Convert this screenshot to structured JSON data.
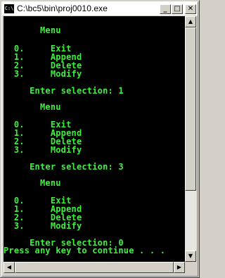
{
  "window": {
    "title": "C:\\bc5\\bin\\proj0010.exe",
    "icon": "C:\\",
    "buttons": {
      "minimize": "_",
      "maximize": "□",
      "close": "✕"
    }
  },
  "console": {
    "lines": [
      "       Menu",
      "",
      "  0.     Exit",
      "  1.     Append",
      "  2.     Delete",
      "  3.     Modify",
      "",
      "     Enter selection: 1",
      "",
      "       Menu",
      "",
      "  0.     Exit",
      "  1.     Append",
      "  2.     Delete",
      "  3.     Modify",
      "",
      "     Enter selection: 3",
      "",
      "       Menu",
      "",
      "  0.     Exit",
      "  1.     Append",
      "  2.     Delete",
      "  3.     Modify",
      "",
      "     Enter selection: 0",
      "Press any key to continue . . ."
    ]
  },
  "scrollbars": {
    "up": "▲",
    "down": "▼",
    "left": "◀",
    "right": "▶"
  },
  "colors": {
    "console_bg": "#000000",
    "console_text": "#3ef03e",
    "chrome": "#d4d0c8"
  }
}
